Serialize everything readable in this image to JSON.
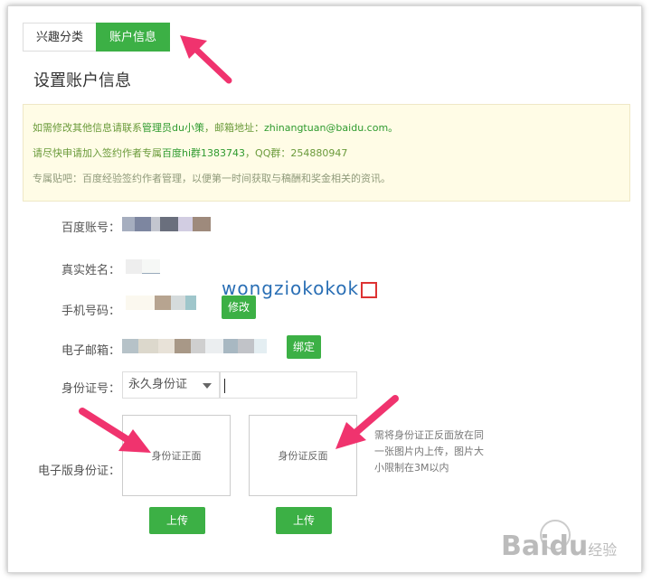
{
  "tabs": [
    {
      "label": "兴趣分类",
      "active": false
    },
    {
      "label": "账户信息",
      "active": true
    }
  ],
  "page_title": "设置账户信息",
  "notice": {
    "line1_prefix": "如需修改其他信息请联系",
    "line1_admin": "管理员du小策",
    "line1_mid": "，邮箱地址：",
    "line1_email": "zhinangtuan@baidu.com。",
    "line2_prefix": "请尽快申请加入签约作者专属",
    "line2_group": "百度hi群1383743",
    "line2_qq": "，QQ群：254880947",
    "line3": "专属贴吧：百度经验签约作者管理，以便第一时间获取与稿酬和奖金相关的资讯。"
  },
  "fields": {
    "baidu_account_label": "百度账号：",
    "real_name_label": "真实姓名：",
    "phone_label": "手机号码：",
    "phone_button": "修改",
    "email_label": "电子邮箱：",
    "email_button": "绑定",
    "id_number_label": "身份证号：",
    "id_type_selected": "永久身份证",
    "id_input_value": "",
    "electronic_id_label": "电子版身份证："
  },
  "upload": {
    "front_label": "身份证正面",
    "back_label": "身份证反面",
    "front_button": "上传",
    "back_button": "上传",
    "hint": "需将身份证正反面放在同一张图片内上传，图片大小限制在3M以内"
  },
  "watermark_text": "wongziokokok",
  "baidu_watermark": {
    "brand": "Baidu",
    "sub": "经验"
  },
  "colors": {
    "accent_green": "#3cb045",
    "notice_bg": "#fffce6",
    "arrow": "#f0336e"
  }
}
